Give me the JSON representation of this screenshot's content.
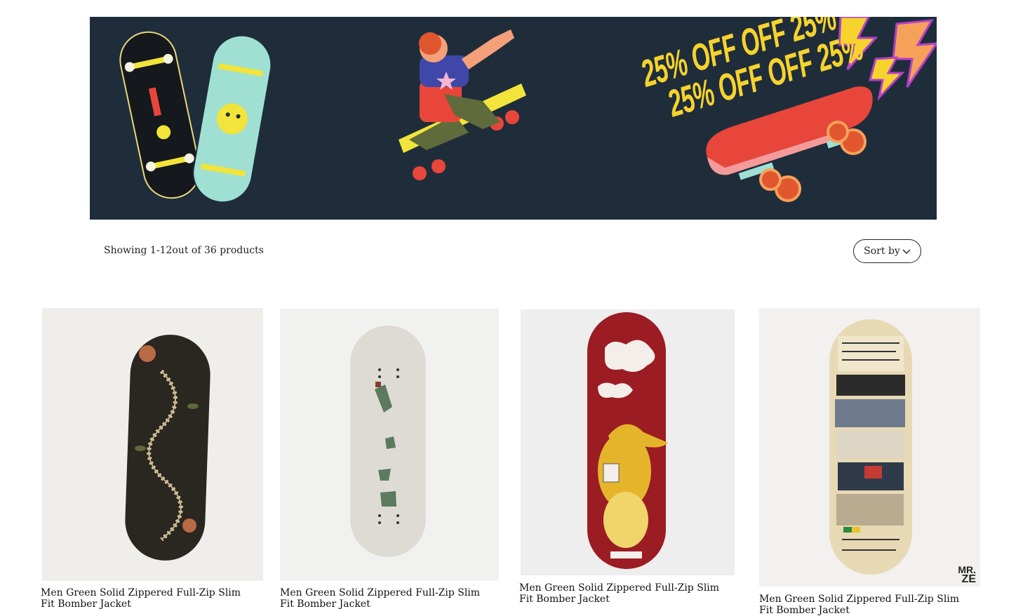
{
  "banner": {
    "promo_line_1": "25% OFF OFF 25%",
    "promo_line_2": "25% OFF OFF 25%",
    "colors": {
      "background": "#1f2d3b",
      "text": "#f6d32d",
      "board_red": "#e8463a",
      "board_teal": "#9fe0d2",
      "board_yellow": "#f2e43a"
    }
  },
  "listing": {
    "count_text": "Showing 1-12out of 36 products",
    "sort_label": "Sort by",
    "sort_icon": "chevron-down-icon"
  },
  "products": [
    {
      "title": "Men Green Solid Zippered Full-Zip Slim Fit Bomber Jacket",
      "image": "skateboard-snake-skeleton"
    },
    {
      "title": "Men Green Solid Zippered Full-Zip Slim Fit Bomber Jacket",
      "image": "skateboard-broken-bottle"
    },
    {
      "title": "Men Green Solid Zippered Full-Zip Slim Fit Bomber Jacket",
      "image": "skateboard-yellow-anteater"
    },
    {
      "title": "Men Green Solid Zippered Full-Zip Slim Fit Bomber Jacket",
      "image": "skateboard-collage",
      "logo_text": "MR. ZE"
    }
  ]
}
